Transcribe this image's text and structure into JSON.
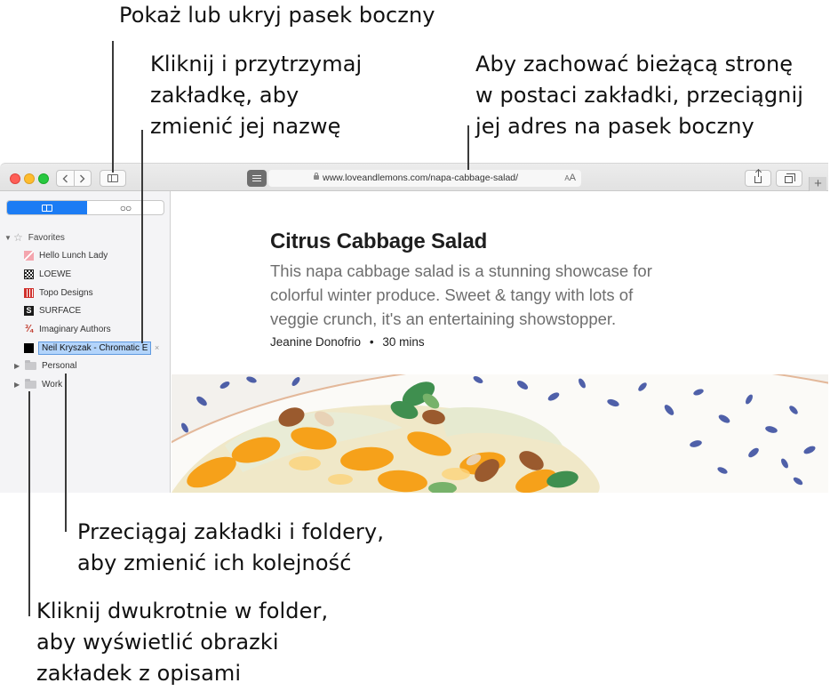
{
  "callouts": {
    "sidebar_toggle": [
      "Pokaż lub ukryj pasek boczny"
    ],
    "rename": [
      "Kliknij i przytrzymaj",
      "zakładkę, aby",
      "zmienić jej nazwę"
    ],
    "save_page": [
      "Aby zachować bieżącą stronę",
      "w postaci zakładki, przeciągnij",
      "jej adres na pasek boczny"
    ],
    "reorder": [
      "Przeciągaj zakładki i foldery,",
      "aby zmienić ich kolejność"
    ],
    "folder": [
      "Kliknij dwukrotnie w folder,",
      "aby wyświetlić obrazki",
      "zakładek z opisami"
    ]
  },
  "toolbar": {
    "back_icon": "chevron-left",
    "forward_icon": "chevron-right",
    "url": "www.loveandlemons.com/napa-cabbage-salad/",
    "text_size_large": "A",
    "text_size_small": "A",
    "new_tab": "+"
  },
  "sidebar": {
    "tabs": {
      "bookmarks_icon": "book",
      "reading_list_icon": "glasses",
      "reading_list_glyph": "○○"
    },
    "favorites_label": "Favorites",
    "items": [
      {
        "label": "Hello Lunch Lady",
        "icon": "hello-lunch-lady-favicon"
      },
      {
        "label": "LOEWE",
        "icon": "loewe-favicon"
      },
      {
        "label": "Topo Designs",
        "icon": "topo-designs-favicon"
      },
      {
        "label": "SURFACE",
        "icon": "surface-favicon",
        "glyph": "S"
      },
      {
        "label": "Imaginary Authors",
        "icon": "imaginary-authors-favicon",
        "glyph": "¾"
      }
    ],
    "editing_item": {
      "value": "Neil Kryszak - Chromatic E",
      "clear": "×"
    },
    "folders": [
      {
        "label": "Personal"
      },
      {
        "label": "Work"
      }
    ]
  },
  "article": {
    "title": "Citrus Cabbage Salad",
    "description": [
      "This napa cabbage salad is a stunning showcase for",
      "colorful winter produce. Sweet & tangy with lots of",
      "veggie crunch, it's an entertaining showstopper."
    ],
    "author": "Jeanine Donofrio",
    "separator": "•",
    "time": "30 mins"
  },
  "colors": {
    "accent": "#1c7cf4",
    "selection": "#b3d4fb",
    "close": "#fe5f57",
    "minimize": "#febc2e",
    "maximize": "#28c840"
  }
}
